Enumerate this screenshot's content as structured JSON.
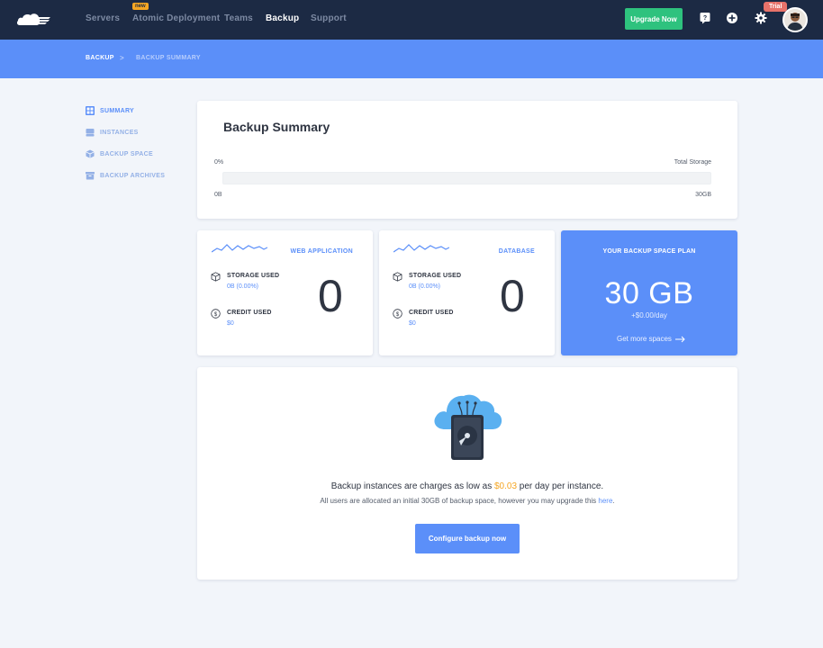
{
  "nav": {
    "items": [
      {
        "label": "Servers",
        "active": false
      },
      {
        "label": "Atomic Deployment",
        "active": false
      },
      {
        "label": "Teams",
        "active": false
      },
      {
        "label": "Backup",
        "active": true
      },
      {
        "label": "Support",
        "active": false
      }
    ],
    "new_badge": "new",
    "upgrade_label": "Upgrade Now",
    "trial_badge": "Trial",
    "icons": [
      "help-icon",
      "plus-circle-icon",
      "gear-icon",
      "avatar"
    ]
  },
  "breadcrumb": {
    "root": "BACKUP",
    "separator": ">",
    "current": "BACKUP SUMMARY"
  },
  "sidebar": {
    "items": [
      {
        "label": "SUMMARY",
        "icon": "grid-icon",
        "active": true
      },
      {
        "label": "INSTANCES",
        "icon": "server-icon",
        "active": false
      },
      {
        "label": "BACKUP SPACE",
        "icon": "cube-icon",
        "active": false
      },
      {
        "label": "BACKUP ARCHIVES",
        "icon": "archive-icon",
        "active": false
      }
    ]
  },
  "summary": {
    "title": "Backup Summary",
    "percent_label": "0%",
    "total_label": "Total Storage",
    "min_label": "0B",
    "max_label": "30GB",
    "used_fraction": 0
  },
  "web_app": {
    "type": "WEB APPLICATION",
    "storage_label": "STORAGE USED",
    "storage_value": "0B (0.00%)",
    "credit_label": "CREDIT USED",
    "credit_value": "$0",
    "count": "0"
  },
  "database": {
    "type": "DATABASE",
    "storage_label": "STORAGE USED",
    "storage_value": "0B (0.00%)",
    "credit_label": "CREDIT USED",
    "credit_value": "$0",
    "count": "0"
  },
  "plan": {
    "title": "YOUR BACKUP SPACE PLAN",
    "size": "30 GB",
    "rate": "+$0.00/day",
    "link": "Get more spaces"
  },
  "cta": {
    "text_before": "Backup instances are charges as low as ",
    "price": "$0.03",
    "text_after": " per day per instance.",
    "sub_before": "All users are allocated an initial 30GB of backup space, however you may upgrade this ",
    "sub_link": "here",
    "sub_after": ".",
    "button": "Configure backup now"
  },
  "colors": {
    "navbar": "#1c2a44",
    "accent": "#5b8ff9",
    "success": "#2ec27e",
    "highlight": "#f5a623",
    "trial": "#e8726a"
  }
}
